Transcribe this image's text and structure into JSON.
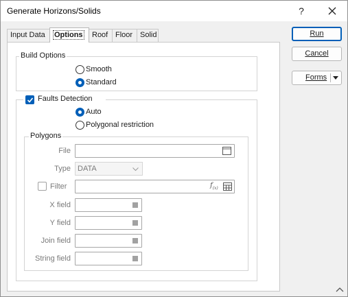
{
  "window": {
    "title": "Generate Horizons/Solids",
    "help": "?"
  },
  "tabs": [
    {
      "label": "Input Data"
    },
    {
      "label": "Options"
    },
    {
      "label": "Roof"
    },
    {
      "label": "Floor"
    },
    {
      "label": "Solid"
    }
  ],
  "build_options": {
    "legend": "Build Options",
    "smooth": "Smooth",
    "standard": "Standard",
    "selected": "Standard"
  },
  "faults": {
    "label": "Faults Detection",
    "checked": true,
    "auto": "Auto",
    "polygonal": "Polygonal restriction",
    "selected": "Auto"
  },
  "polygons": {
    "legend": "Polygons",
    "file_label": "File",
    "file_value": "",
    "type_label": "Type",
    "type_value": "DATA",
    "filter_label": "Filter",
    "filter_checked": false,
    "x_label": "X field",
    "y_label": "Y field",
    "join_label": "Join field",
    "string_label": "String field"
  },
  "buttons": {
    "run": "Run",
    "cancel": "Cancel",
    "forms": "Forms"
  },
  "icons": {
    "close": "close-icon",
    "browse": "browse-icon",
    "filter_expression": "function-icon",
    "list": "list-icon",
    "accent_color": "#005fb8"
  }
}
